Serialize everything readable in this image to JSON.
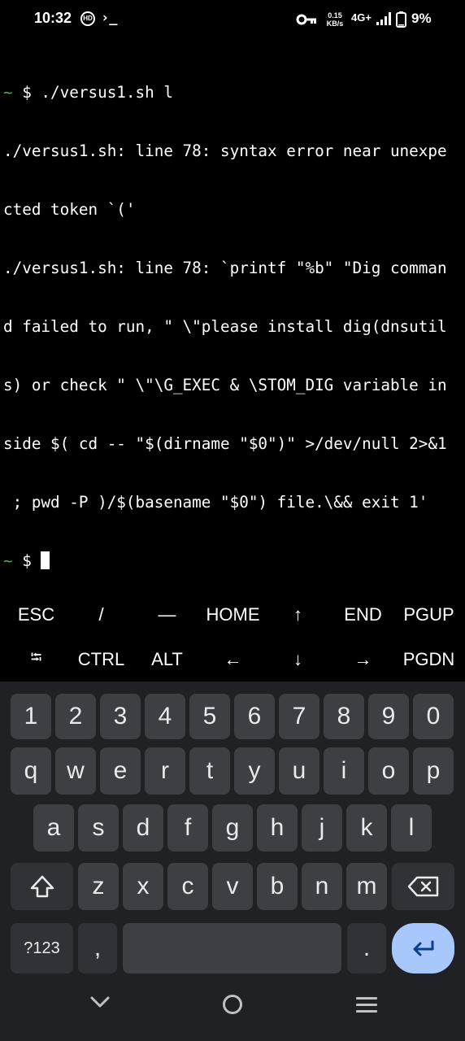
{
  "status_bar": {
    "time": "10:32",
    "hd_label": "HD",
    "terminal_glyph": "›_",
    "net_speed_value": "0.15",
    "net_speed_unit": "KB/s",
    "network_type": "4G+",
    "battery": "9%"
  },
  "terminal": {
    "command": " $ ./versus1.sh l",
    "tilde": "~",
    "output": [
      "./versus1.sh: line 78: syntax error near unexpe",
      "cted token `('",
      "./versus1.sh: line 78: `printf \"%b\" \"Dig comman",
      "d failed to run, \" \\\"please install dig(dnsutil",
      "s) or check \" \\\"\\G_EXEC & \\STOM_DIG variable in",
      "side $( cd -- \"$(dirname \"$0\")\" >/dev/null 2>&1",
      " ; pwd -P )/$(basename \"$0\") file.\\&& exit 1'"
    ],
    "prompt": " $ "
  },
  "extra_keys": {
    "row1": [
      "ESC",
      "/",
      "—",
      "HOME",
      "↑",
      "END",
      "PGUP"
    ],
    "row2": [
      "⭾",
      "CTRL",
      "ALT",
      "←",
      "↓",
      "→",
      "PGDN"
    ]
  },
  "keyboard": {
    "row_numbers": [
      "1",
      "2",
      "3",
      "4",
      "5",
      "6",
      "7",
      "8",
      "9",
      "0"
    ],
    "row_top": [
      "q",
      "w",
      "e",
      "r",
      "t",
      "y",
      "u",
      "i",
      "o",
      "p"
    ],
    "row_home": [
      "a",
      "s",
      "d",
      "f",
      "g",
      "h",
      "j",
      "k",
      "l"
    ],
    "row_bottom": [
      "z",
      "x",
      "c",
      "v",
      "b",
      "n",
      "m"
    ],
    "symbols_label": "?123",
    "comma_label": ",",
    "period_label": "."
  }
}
